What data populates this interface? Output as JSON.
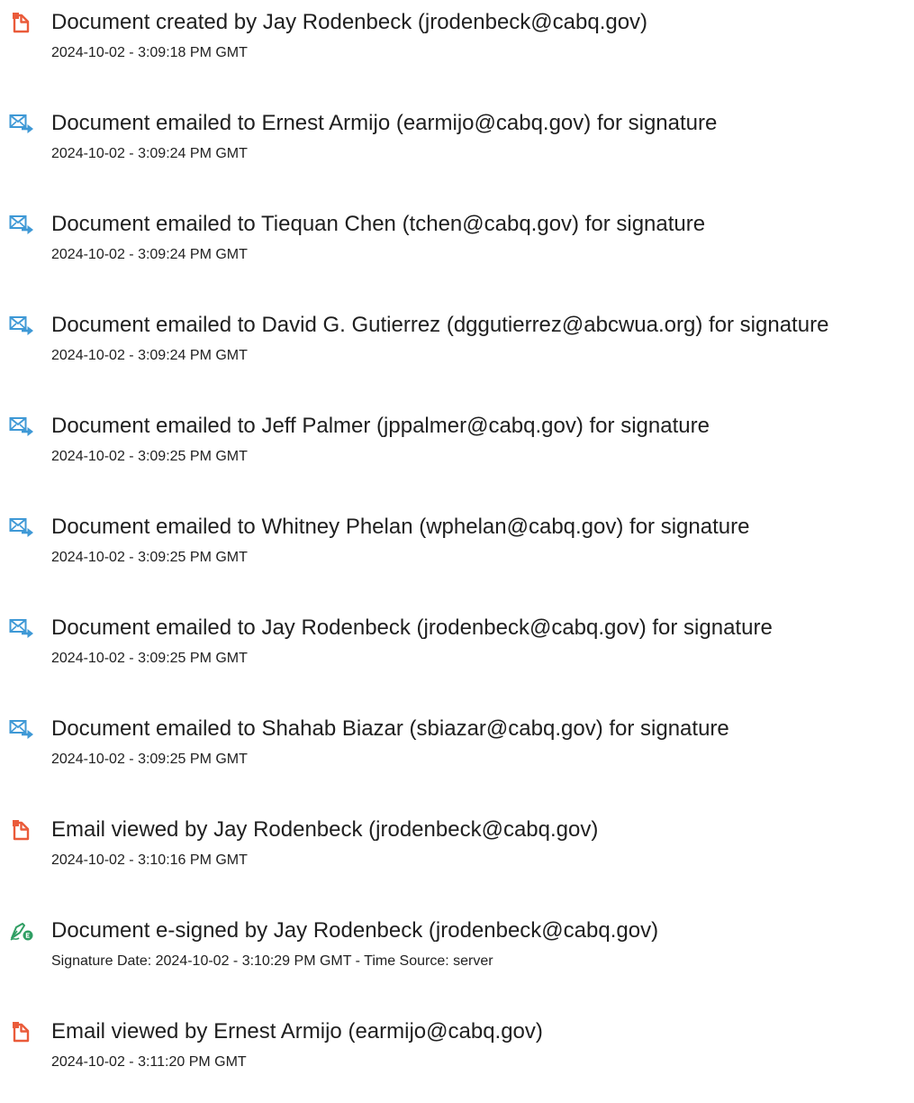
{
  "entries": [
    {
      "icon": "document-icon",
      "title": "Document created by Jay Rodenbeck (jrodenbeck@cabq.gov)",
      "detail": "2024-10-02 - 3:09:18 PM GMT"
    },
    {
      "icon": "email-sent-icon",
      "title": "Document emailed to Ernest Armijo (earmijo@cabq.gov) for signature",
      "detail": "2024-10-02 - 3:09:24 PM GMT"
    },
    {
      "icon": "email-sent-icon",
      "title": "Document emailed to Tiequan Chen (tchen@cabq.gov) for signature",
      "detail": "2024-10-02 - 3:09:24 PM GMT"
    },
    {
      "icon": "email-sent-icon",
      "title": "Document emailed to David G. Gutierrez (dggutierrez@abcwua.org) for signature",
      "detail": "2024-10-02 - 3:09:24 PM GMT"
    },
    {
      "icon": "email-sent-icon",
      "title": "Document emailed to Jeff Palmer (jppalmer@cabq.gov) for signature",
      "detail": "2024-10-02 - 3:09:25 PM GMT"
    },
    {
      "icon": "email-sent-icon",
      "title": "Document emailed to Whitney Phelan (wphelan@cabq.gov) for signature",
      "detail": "2024-10-02 - 3:09:25 PM GMT"
    },
    {
      "icon": "email-sent-icon",
      "title": "Document emailed to Jay Rodenbeck (jrodenbeck@cabq.gov) for signature",
      "detail": "2024-10-02 - 3:09:25 PM GMT"
    },
    {
      "icon": "email-sent-icon",
      "title": "Document emailed to Shahab Biazar (sbiazar@cabq.gov) for signature",
      "detail": "2024-10-02 - 3:09:25 PM GMT"
    },
    {
      "icon": "document-icon",
      "title": "Email viewed by Jay Rodenbeck (jrodenbeck@cabq.gov)",
      "detail": "2024-10-02 - 3:10:16 PM GMT"
    },
    {
      "icon": "esign-pen-icon",
      "title": "Document e-signed by Jay Rodenbeck (jrodenbeck@cabq.gov)",
      "detail": "Signature Date: 2024-10-02 - 3:10:29 PM GMT - Time Source: server"
    },
    {
      "icon": "document-icon",
      "title": "Email viewed by Ernest Armijo (earmijo@cabq.gov)",
      "detail": "2024-10-02 - 3:11:20 PM GMT"
    }
  ],
  "colors": {
    "document_icon": "#ea5b3a",
    "email_icon": "#3f99d6",
    "esign_icon": "#2f9e63"
  }
}
